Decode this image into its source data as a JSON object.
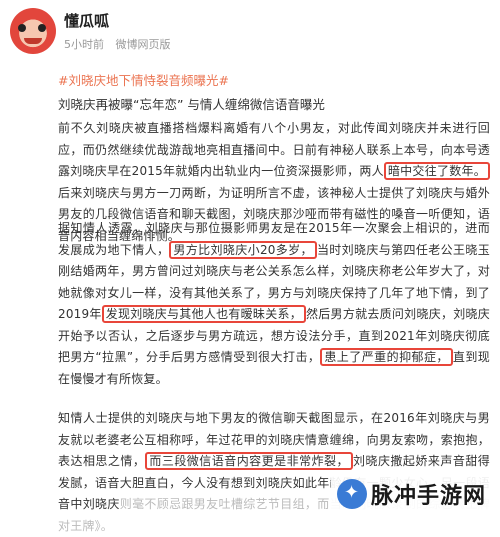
{
  "header": {
    "username": "懂瓜呱",
    "time": "5小时前",
    "source": "微博网页版"
  },
  "topic": "#刘晓庆地下情恃裂音频曝光#",
  "subtitle": "刘晓庆再被曝“忘年恋” 与情人缠绵微信语音曝光",
  "p1": {
    "a": "前不久刘晓庆被直播搭档爆料离婚有八个小男友，对此传闻刘晓庆并未进行回应，而仍然继续优哉游哉地亮相直播间中。日前有神秘人联系上本号，向本号透露刘晓庆早在2015年就婚内出轨业内一位资深摄影师，两人",
    "hl": "暗中交往了数年。",
    "b": "后来刘晓庆与男方一刀两断，为证明所言不虚，该神秘人士提供了刘晓庆与婚外男友的几段微信语音和聊天截图，刘晓庆那沙哑而带有磁性的嗓音一听便知，语音内容相当缠绵悱恻。"
  },
  "p2": {
    "a": "据知情人透露，刘晓庆与那位摄影师男友是在2015年一次聚会上相识的，进而发展成为地下情人，",
    "hl1": "男方比刘晓庆小20多岁，",
    "b": "当时刘晓庆与第四任老公王晓玉刚结婚两年，男方曾问过刘晓庆与老公关系怎么样，刘晓庆称老公年岁大了，对她就像对女儿一样，没有其他关系了，男方与刘晓庆保持了几年了地下情，到了2019年",
    "hl2": "发现刘晓庆与其他人也有暧昧关系，",
    "c": "然后男方就去质问刘晓庆，刘晓庆开始予以否认，之后逐步与男方疏远，想方设法分手，直到2021年刘晓庆彻底把男方“拉黑”，分手后男方感情受到很大打击，",
    "hl3": "患上了严重的抑郁症，",
    "d": "直到现在慢慢才有所恢复。"
  },
  "p3": {
    "a": "知情人士提供的刘晓庆与地下男友的微信聊天截图显示，在2016年刘晓庆与男友就以老婆老公互相称呼，年过花甲的刘晓庆情意缠绵，向男友索吻，索抱抱，表达相思之情，",
    "hl": "而三段微信语音内容更是非常炸裂，",
    "b": "刘晓庆撒起娇来声音甜得发腻，语音大胆直白，今人没有想到刘晓庆如此年龄仍有一颗少女心，另一段语音中刘晓庆",
    "c": "则毫不顾忌跟男友吐槽综艺节目组，而当时刘晓庆录制的综艺",
    "d": "《王牌对王牌》。"
  },
  "watermark": {
    "text": "脉冲手游网",
    "icon": "pulse-logo-icon"
  },
  "colors": {
    "accent": "#eb7350",
    "highlight_border": "#e8463a"
  }
}
